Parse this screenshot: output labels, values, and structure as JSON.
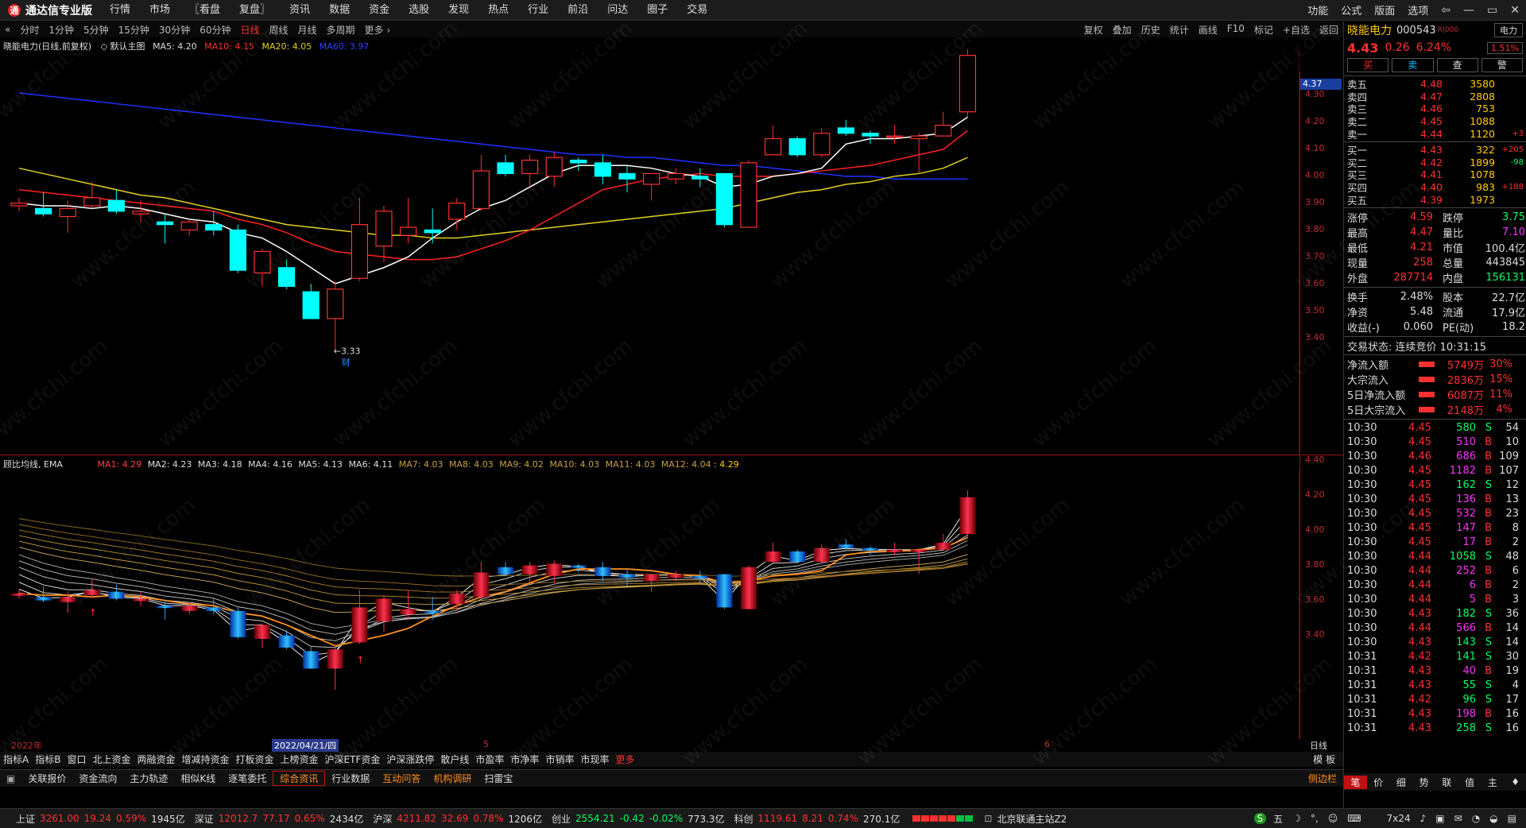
{
  "app": {
    "title": "通达信专业版"
  },
  "menu": [
    "行情",
    "市场",
    "〖看盘",
    "复盘〗",
    "资讯",
    "数据",
    "资金",
    "选股",
    "发现",
    "热点",
    "行业",
    "前沿",
    "问达",
    "圈子",
    "交易"
  ],
  "topright": [
    "功能",
    "公式",
    "版面",
    "选项"
  ],
  "periods": [
    "分时",
    "1分钟",
    "5分钟",
    "15分钟",
    "30分钟",
    "60分钟",
    "日线",
    "周线",
    "月线",
    "多周期",
    "更多 ›"
  ],
  "active_period": "日线",
  "chart_tools": [
    "复权",
    "叠加",
    "历史",
    "统计",
    "画线",
    "F10",
    "标记",
    "+自选",
    "返回"
  ],
  "main_label": {
    "name": "晓能电力(日线,前复权)",
    "template": "◇ 默认主图",
    "ma5": "MA5: 4.20",
    "ma10": "MA10: 4.15",
    "ma20": "MA20: 4.05",
    "ma60": "MA60: 3.97"
  },
  "colors": {
    "up": "#ff3030",
    "down": "#00ffff",
    "ma5": "#ffffff",
    "ma10": "#ff2020",
    "ma20": "#e0d020",
    "ma60": "#2030ff"
  },
  "price_axis": [
    "4.37",
    "4.30",
    "4.20",
    "4.10",
    "4.00",
    "3.90",
    "3.80",
    "3.70",
    "3.60",
    "3.50",
    "3.40"
  ],
  "current_price_tag": "4.37",
  "high_label": "4.47",
  "low_label": "3.33",
  "low_badge": "财",
  "sub_label": {
    "name": "顾比均线, EMA",
    "ma1": "MA1: 4.29",
    "ma2": "MA2: 4.23",
    "ma3": "MA3: 4.18",
    "ma4": "MA4: 4.16",
    "ma5": "MA5: 4.13",
    "ma6": "MA6: 4.11",
    "ma7": "MA7: 4.03",
    "ma8": "MA8: 4.03",
    "ma9": "MA9: 4.02",
    "ma10": "MA10: 4.03",
    "ma11": "MA11: 4.03",
    "ma12": "MA12: 4.04",
    "last": ": 4.29"
  },
  "sub_axis": [
    "4.40",
    "4.20",
    "4.00",
    "3.80",
    "3.60",
    "3.40"
  ],
  "dates": {
    "start": "2022年",
    "cursor": "2022/04/21/四",
    "m5": "5",
    "m6": "6",
    "period": "日线"
  },
  "bottom_tabs1": [
    "指标A",
    "指标B",
    "窗口",
    "北上资金",
    "两融资金",
    "增减持资金",
    "打板资金",
    "上榜资金",
    "沪深ETF资金",
    "沪深涨跌停",
    "散户线",
    "市盈率",
    "市净率",
    "市销率",
    "市现率",
    "更多"
  ],
  "bottom_tabs1_right": "模 板",
  "bottom_tabs2": [
    "关联报价",
    "资金流向",
    "主力轨迹",
    "相似K线",
    "逐笔委托",
    "综合资讯",
    "行业数据",
    "互动问答",
    "机构调研",
    "扫雷宝"
  ],
  "bottom_tabs2_right": "侧边栏",
  "status": {
    "sh": "上证",
    "sh_v": "3261.00",
    "sh_c": "19.24",
    "sh_p": "0.59%",
    "sh_a": "1945亿",
    "sz": "深证",
    "sz_v": "12012.7",
    "sz_c": "77.17",
    "sz_p": "0.65%",
    "sz_a": "2434亿",
    "hs": "沪深",
    "hs_v": "4211.82",
    "hs_c": "32.69",
    "hs_p": "0.78%",
    "hs_a": "1206亿",
    "cy": "创业",
    "cy_v": "2554.21",
    "cy_c": "-0.42",
    "cy_p": "-0.02%",
    "cy_a": "773.3亿",
    "kc": "科创",
    "kc_v": "1119.61",
    "kc_c": "8.21",
    "kc_p": "0.74%",
    "kc_a": "270.1亿",
    "server": "北京联通主站Z2",
    "hours": "7x24"
  },
  "quote": {
    "name": "晓能电力",
    "code": "000543",
    "tag": "R|000",
    "badge": "电力",
    "badge2": "1.51%",
    "price": "4.43",
    "change": "0.26",
    "pct": "6.24%",
    "buttons": [
      "买",
      "卖",
      "查",
      "警"
    ],
    "asks": [
      [
        "卖五",
        "4.48",
        "3580",
        ""
      ],
      [
        "卖四",
        "4.47",
        "2808",
        ""
      ],
      [
        "卖三",
        "4.46",
        "753",
        ""
      ],
      [
        "卖二",
        "4.45",
        "1088",
        ""
      ],
      [
        "卖一",
        "4.44",
        "1120",
        "+3"
      ]
    ],
    "bids": [
      [
        "买一",
        "4.43",
        "322",
        "+205"
      ],
      [
        "买二",
        "4.42",
        "1899",
        "-98"
      ],
      [
        "买三",
        "4.41",
        "1078",
        ""
      ],
      [
        "买四",
        "4.40",
        "983",
        "+188"
      ],
      [
        "买五",
        "4.39",
        "1973",
        ""
      ]
    ],
    "stats": [
      [
        "涨停",
        "4.59",
        "跌停",
        "3.75"
      ],
      [
        "最高",
        "4.47",
        "量比",
        "7.10"
      ],
      [
        "最低",
        "4.21",
        "市值",
        "100.4亿"
      ],
      [
        "现量",
        "258",
        "总量",
        "443845"
      ],
      [
        "外盘",
        "287714",
        "内盘",
        "156131"
      ]
    ],
    "stats2": [
      [
        "换手",
        "2.48%",
        "股本",
        "22.7亿"
      ],
      [
        "净资",
        "5.48",
        "流通",
        "17.9亿"
      ],
      [
        "收益(-)",
        "0.060",
        "PE(动)",
        "18.2"
      ]
    ],
    "state": "交易状态: 连续竞价 10:31:15",
    "flows": [
      [
        "净流入额",
        "5749万",
        "30%"
      ],
      [
        "大宗流入",
        "2836万",
        "15%"
      ],
      [
        "5日净流入额",
        "6087万",
        "11%"
      ],
      [
        "5日大宗流入",
        "2148万",
        "4%"
      ]
    ],
    "ticks": [
      [
        "10:30",
        "4.45",
        "580",
        "S",
        "54"
      ],
      [
        "10:30",
        "4.45",
        "510",
        "B",
        "10"
      ],
      [
        "10:30",
        "4.46",
        "686",
        "B",
        "109"
      ],
      [
        "10:30",
        "4.45",
        "1182",
        "B",
        "107"
      ],
      [
        "10:30",
        "4.45",
        "162",
        "S",
        "12"
      ],
      [
        "10:30",
        "4.45",
        "136",
        "B",
        "13"
      ],
      [
        "10:30",
        "4.45",
        "532",
        "B",
        "23"
      ],
      [
        "10:30",
        "4.45",
        "147",
        "B",
        "8"
      ],
      [
        "10:30",
        "4.45",
        "17",
        "B",
        "2"
      ],
      [
        "10:30",
        "4.44",
        "1058",
        "S",
        "48"
      ],
      [
        "10:30",
        "4.44",
        "252",
        "B",
        "6"
      ],
      [
        "10:30",
        "4.44",
        "6",
        "B",
        "2"
      ],
      [
        "10:30",
        "4.44",
        "5",
        "B",
        "3"
      ],
      [
        "10:30",
        "4.43",
        "182",
        "S",
        "36"
      ],
      [
        "10:30",
        "4.44",
        "566",
        "B",
        "14"
      ],
      [
        "10:30",
        "4.43",
        "143",
        "S",
        "14"
      ],
      [
        "10:31",
        "4.42",
        "141",
        "S",
        "30"
      ],
      [
        "10:31",
        "4.43",
        "40",
        "B",
        "19"
      ],
      [
        "10:31",
        "4.43",
        "55",
        "S",
        "4"
      ],
      [
        "10:31",
        "4.42",
        "96",
        "S",
        "17"
      ],
      [
        "10:31",
        "4.43",
        "198",
        "B",
        "16"
      ],
      [
        "10:31",
        "4.43",
        "258",
        "S",
        "16"
      ]
    ],
    "rtabs": [
      "笔",
      "价",
      "细",
      "势",
      "联",
      "值",
      "主",
      "♦"
    ]
  },
  "watermark": "www.cfchi.com",
  "chart_data": {
    "type": "candlestick",
    "title": "晓能电力(日线,前复权)",
    "ylim": [
      3.33,
      4.47
    ],
    "candles": [
      [
        3.87,
        3.9,
        3.85,
        3.88
      ],
      [
        3.86,
        3.92,
        3.83,
        3.84
      ],
      [
        3.83,
        3.89,
        3.77,
        3.86
      ],
      [
        3.87,
        3.96,
        3.86,
        3.9
      ],
      [
        3.89,
        3.93,
        3.84,
        3.85
      ],
      [
        3.84,
        3.89,
        3.81,
        3.85
      ],
      [
        3.81,
        3.84,
        3.73,
        3.8
      ],
      [
        3.78,
        3.82,
        3.76,
        3.81
      ],
      [
        3.8,
        3.85,
        3.76,
        3.78
      ],
      [
        3.78,
        3.8,
        3.62,
        3.63
      ],
      [
        3.62,
        3.71,
        3.57,
        3.7
      ],
      [
        3.64,
        3.67,
        3.56,
        3.57
      ],
      [
        3.55,
        3.58,
        3.45,
        3.45
      ],
      [
        3.45,
        3.59,
        3.33,
        3.56
      ],
      [
        3.6,
        3.9,
        3.59,
        3.8
      ],
      [
        3.72,
        3.87,
        3.66,
        3.85
      ],
      [
        3.76,
        3.9,
        3.73,
        3.79
      ],
      [
        3.78,
        3.86,
        3.73,
        3.77
      ],
      [
        3.82,
        3.9,
        3.78,
        3.88
      ],
      [
        3.86,
        4.06,
        3.85,
        4.0
      ],
      [
        4.03,
        4.06,
        3.98,
        3.99
      ],
      [
        3.99,
        4.06,
        3.94,
        4.04
      ],
      [
        3.98,
        4.07,
        3.94,
        4.05
      ],
      [
        4.04,
        4.05,
        4.0,
        4.03
      ],
      [
        4.03,
        4.06,
        3.95,
        3.98
      ],
      [
        3.99,
        4.02,
        3.92,
        3.97
      ],
      [
        3.95,
        3.97,
        3.89,
        3.99
      ],
      [
        3.97,
        4.01,
        3.95,
        3.99
      ],
      [
        3.98,
        4.01,
        3.94,
        3.97
      ],
      [
        3.99,
        3.99,
        3.79,
        3.8
      ],
      [
        3.79,
        4.04,
        3.79,
        4.03
      ],
      [
        4.06,
        4.17,
        4.06,
        4.12
      ],
      [
        4.12,
        4.13,
        4.05,
        4.06
      ],
      [
        4.06,
        4.16,
        4.05,
        4.14
      ],
      [
        4.16,
        4.19,
        4.13,
        4.14
      ],
      [
        4.14,
        4.15,
        4.1,
        4.13
      ],
      [
        4.13,
        4.17,
        4.1,
        4.13
      ],
      [
        4.12,
        4.14,
        3.99,
        4.13
      ],
      [
        4.13,
        4.22,
        4.13,
        4.17
      ],
      [
        4.22,
        4.47,
        4.2,
        4.43
      ]
    ],
    "ma5": [
      3.88,
      3.87,
      3.87,
      3.86,
      3.87,
      3.86,
      3.84,
      3.82,
      3.81,
      3.77,
      3.75,
      3.7,
      3.64,
      3.58,
      3.61,
      3.64,
      3.68,
      3.75,
      3.81,
      3.86,
      3.89,
      3.94,
      3.99,
      4.02,
      4.02,
      4.02,
      4.01,
      3.99,
      3.98,
      3.94,
      3.95,
      3.98,
      3.99,
      4.01,
      4.1,
      4.12,
      4.12,
      4.13,
      4.14,
      4.2
    ],
    "ma10": [
      3.93,
      3.92,
      3.91,
      3.9,
      3.89,
      3.88,
      3.87,
      3.86,
      3.85,
      3.82,
      3.8,
      3.77,
      3.73,
      3.7,
      3.69,
      3.68,
      3.67,
      3.67,
      3.68,
      3.71,
      3.74,
      3.78,
      3.83,
      3.88,
      3.93,
      3.95,
      3.97,
      3.98,
      3.99,
      3.98,
      3.98,
      3.98,
      3.99,
      4.0,
      4.01,
      4.02,
      4.04,
      4.06,
      4.08,
      4.15
    ],
    "ma20": [
      4.01,
      3.99,
      3.97,
      3.95,
      3.93,
      3.91,
      3.9,
      3.88,
      3.86,
      3.84,
      3.82,
      3.8,
      3.79,
      3.78,
      3.77,
      3.76,
      3.76,
      3.75,
      3.75,
      3.76,
      3.77,
      3.78,
      3.79,
      3.8,
      3.81,
      3.82,
      3.83,
      3.84,
      3.85,
      3.86,
      3.88,
      3.9,
      3.92,
      3.93,
      3.95,
      3.96,
      3.98,
      3.99,
      4.01,
      4.05
    ],
    "ma60": [
      4.29,
      4.28,
      4.27,
      4.26,
      4.25,
      4.24,
      4.23,
      4.22,
      4.21,
      4.2,
      4.19,
      4.18,
      4.17,
      4.16,
      4.15,
      4.14,
      4.13,
      4.12,
      4.11,
      4.1,
      4.09,
      4.08,
      4.07,
      4.06,
      4.06,
      4.05,
      4.05,
      4.04,
      4.03,
      4.02,
      4.02,
      4.01,
      4.0,
      3.99,
      3.98,
      3.98,
      3.97,
      3.97,
      3.97,
      3.97
    ]
  }
}
